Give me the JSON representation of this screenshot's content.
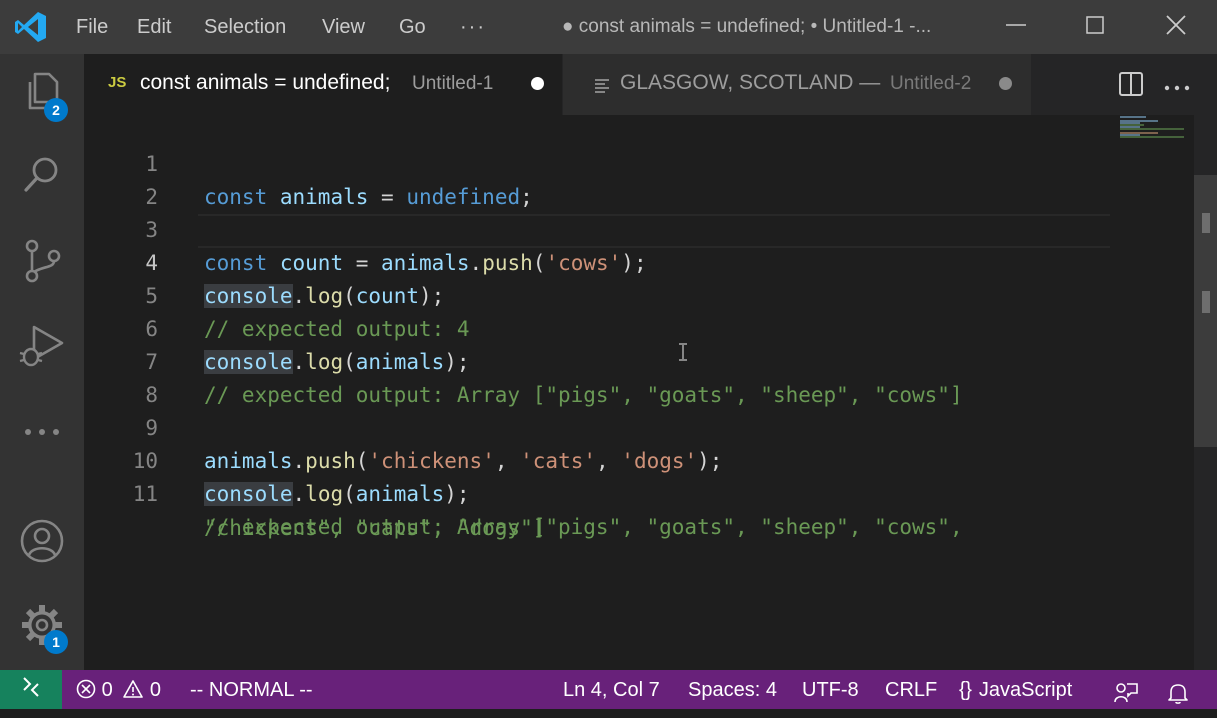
{
  "titlebar": {
    "menu": [
      "File",
      "Edit",
      "Selection",
      "View",
      "Go",
      "···"
    ],
    "window_title": "● const animals = undefined; • Untitled-1 -..."
  },
  "activity": {
    "explorer_badge": "2",
    "settings_badge": "1"
  },
  "tabs": [
    {
      "icon": "JS",
      "label": "const animals = undefined;",
      "description": "Untitled-1",
      "dirty": true,
      "active": true
    },
    {
      "icon": "text-lines",
      "label": "GLASGOW, SCOTLAND —",
      "description": "Untitled-2",
      "dirty": true,
      "active": false
    }
  ],
  "editor": {
    "line_numbers": [
      "1",
      "2",
      "3",
      "4",
      "5",
      "6",
      "7",
      "8",
      "9",
      "10",
      "11"
    ],
    "current_line": 4,
    "lines": {
      "l1": {
        "kw": "const",
        "var": "animals",
        "eq": " = ",
        "undef": "undefined",
        "semi": ";"
      },
      "l3": {
        "kw": "const",
        "var": "count",
        "eq": " = ",
        "obj": "animals",
        "dot": ".",
        "fn": "push",
        "open": "(",
        "str": "'cows'",
        "close": ");"
      },
      "l4": {
        "obj": "console",
        "dot": ".",
        "fn": "log",
        "open": "(",
        "arg": "count",
        "close": ");"
      },
      "l5": {
        "comment": "// expected output: 4"
      },
      "l6": {
        "obj": "console",
        "dot": ".",
        "fn": "log",
        "open": "(",
        "arg": "animals",
        "close": ");"
      },
      "l7": {
        "comment": "// expected output: Array [\"pigs\", \"goats\", \"sheep\", \"cows\"]"
      },
      "l9": {
        "obj": "animals",
        "dot": ".",
        "fn": "push",
        "open": "(",
        "s1": "'chickens'",
        "c1": ", ",
        "s2": "'cats'",
        "c2": ", ",
        "s3": "'dogs'",
        "close": ");"
      },
      "l10": {
        "obj": "console",
        "dot": ".",
        "fn": "log",
        "open": "(",
        "arg": "animals",
        "close": ");"
      },
      "l11a": {
        "comment": "// expected output: Array [\"pigs\", \"goats\", \"sheep\", \"cows\","
      },
      "l11b": {
        "comment": "\"chickens\", \"cats\", \"dogs\"]"
      }
    }
  },
  "statusbar": {
    "errors": "0",
    "warnings": "0",
    "mode": "-- NORMAL --",
    "position": "Ln 4, Col 7",
    "spaces": "Spaces: 4",
    "encoding": "UTF-8",
    "eol": "CRLF",
    "language_braces": "{ }",
    "language": "JavaScript"
  },
  "colors": {
    "statusbar": "#68217a",
    "remote": "#16825d",
    "badge": "#007acc",
    "js_icon": "#cbcb41"
  }
}
